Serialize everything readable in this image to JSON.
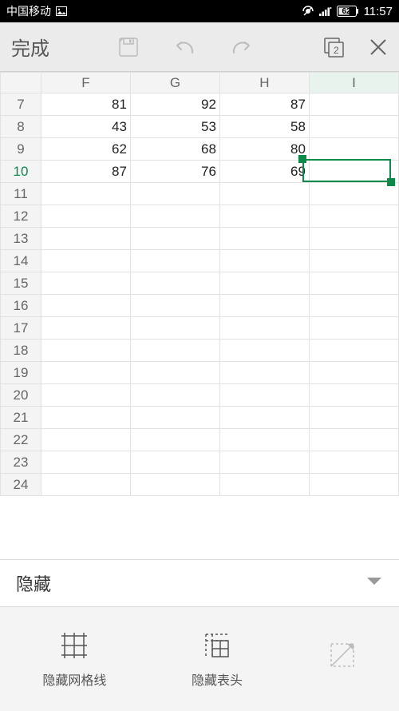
{
  "status": {
    "carrier": "中国移动",
    "battery": "62",
    "time": "11:57"
  },
  "toolbar": {
    "done": "完成",
    "window_count": "2"
  },
  "sheet": {
    "columns": [
      "F",
      "G",
      "H",
      "I"
    ],
    "row_start": 7,
    "row_end": 24,
    "selected_row": 10,
    "selected_col": "I",
    "data": {
      "7": {
        "F": "81",
        "G": "92",
        "H": "87"
      },
      "8": {
        "F": "43",
        "G": "53",
        "H": "58"
      },
      "9": {
        "F": "62",
        "G": "68",
        "H": "80"
      },
      "10": {
        "F": "87",
        "G": "76",
        "H": "69"
      }
    }
  },
  "panel": {
    "title": "隐藏"
  },
  "bottom": {
    "gridlines": "隐藏网格线",
    "headers": "隐藏表头",
    "third": ""
  }
}
